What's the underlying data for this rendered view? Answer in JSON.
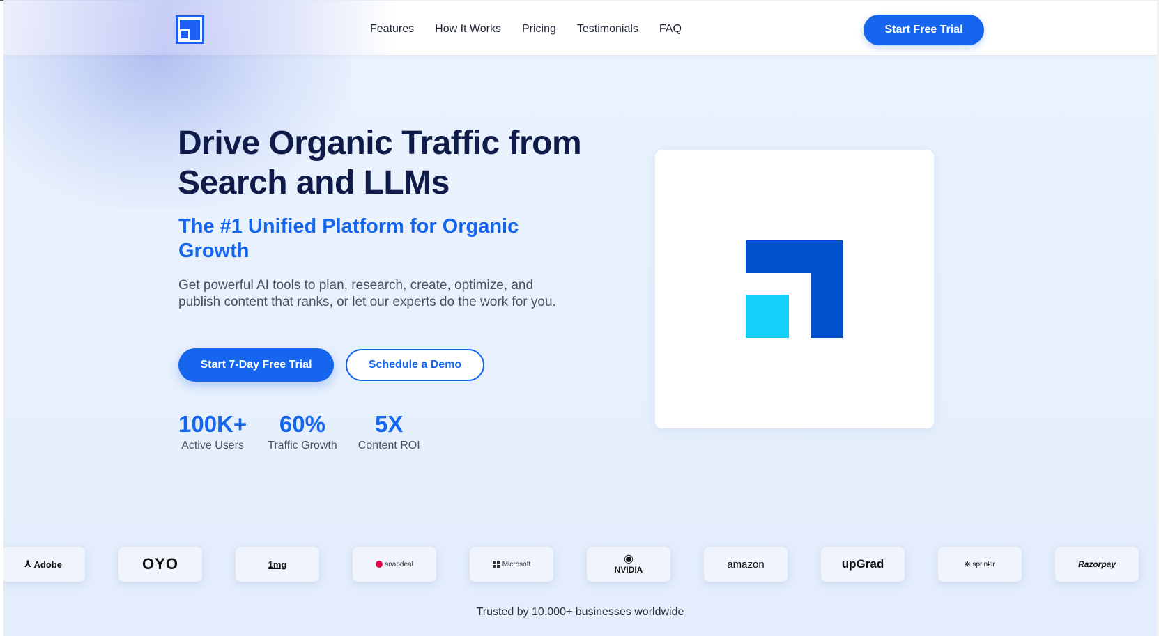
{
  "nav": {
    "logo_icon": "brand-logo-icon",
    "links": [
      "Features",
      "How It Works",
      "Pricing",
      "Testimonials",
      "FAQ"
    ],
    "cta_label": "Start Free Trial"
  },
  "hero": {
    "title": "Drive Organic Traffic from Search and LLMs",
    "subtitle": "The #1 Unified Platform for Organic Growth",
    "description": "Get powerful AI tools to plan, research, create, optimize, and publish content that ranks, or let our experts do the work for you.",
    "primary_cta": "Start 7-Day Free Trial",
    "secondary_cta": "Schedule a Demo",
    "stats": [
      {
        "value": "100K+",
        "label": "Active Users"
      },
      {
        "value": "60%",
        "label": "Traffic Growth"
      },
      {
        "value": "5X",
        "label": "Content ROI"
      }
    ],
    "illustration_icon": "brand-mark-icon"
  },
  "logos": {
    "items": [
      "Adobe",
      "OYO",
      "1mg",
      "snapdeal",
      "Microsoft",
      "NVIDIA",
      "amazon",
      "upGrad",
      "sprinklr",
      "Razorpay"
    ],
    "caption": "Trusted by 10,000+ businesses worldwide"
  },
  "colors": {
    "accent": "#1565ef",
    "heading": "#0f1c4a",
    "brand_dark": "#0052cc",
    "brand_light": "#12d0fa"
  }
}
